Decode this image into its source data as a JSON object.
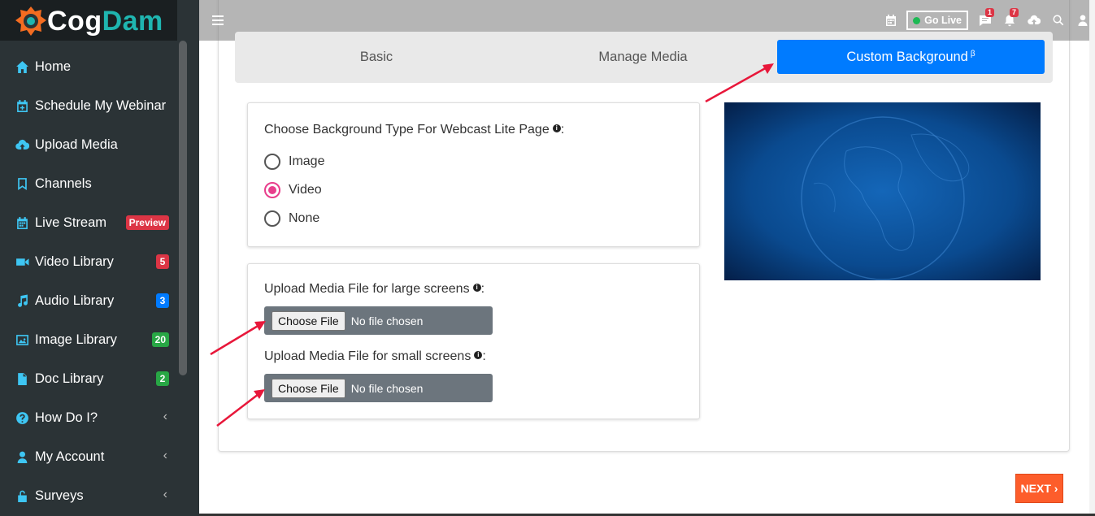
{
  "app": {
    "logo_part1": "Cog",
    "logo_part2": "Dam"
  },
  "sidebar": {
    "items": [
      {
        "label": "Home",
        "icon": "home-icon"
      },
      {
        "label": "Schedule My Webinar",
        "icon": "calendar-plus-icon"
      },
      {
        "label": "Upload Media",
        "icon": "cloud-upload-icon"
      },
      {
        "label": "Channels",
        "icon": "bookmark-icon"
      },
      {
        "label": "Live Stream",
        "icon": "calendar-icon",
        "badge": "Preview"
      },
      {
        "label": "Video Library",
        "icon": "video-icon",
        "badge": "5"
      },
      {
        "label": "Audio Library",
        "icon": "music-icon",
        "badge": "3"
      },
      {
        "label": "Image Library",
        "icon": "image-icon",
        "badge": "20"
      },
      {
        "label": "Doc Library",
        "icon": "document-icon",
        "badge": "2"
      },
      {
        "label": "How Do I?",
        "icon": "question-icon"
      },
      {
        "label": "My Account",
        "icon": "user-icon"
      },
      {
        "label": "Surveys",
        "icon": "lock-icon"
      }
    ]
  },
  "topbar": {
    "go_live": "Go Live",
    "messages_count": "1",
    "notifications_count": "7"
  },
  "tabs": {
    "basic": "Basic",
    "manage_media": "Manage Media",
    "custom_background": "Custom Background",
    "custom_background_sup": "β"
  },
  "background_type": {
    "label": "Choose Background Type For Webcast Lite Page",
    "suffix": ":",
    "options": [
      "Image",
      "Video",
      "None"
    ],
    "selected": "Video"
  },
  "upload": {
    "large_label": "Upload Media File for large screens",
    "small_label": "Upload Media File for small screens",
    "suffix": ":",
    "choose_file": "Choose File",
    "no_file": "No file chosen"
  },
  "actions": {
    "next": "NEXT ›"
  },
  "colors": {
    "accent": "#007bff",
    "next": "#fd5d2b",
    "radio_selected": "#e83e8c",
    "arrow": "#e8173a"
  }
}
